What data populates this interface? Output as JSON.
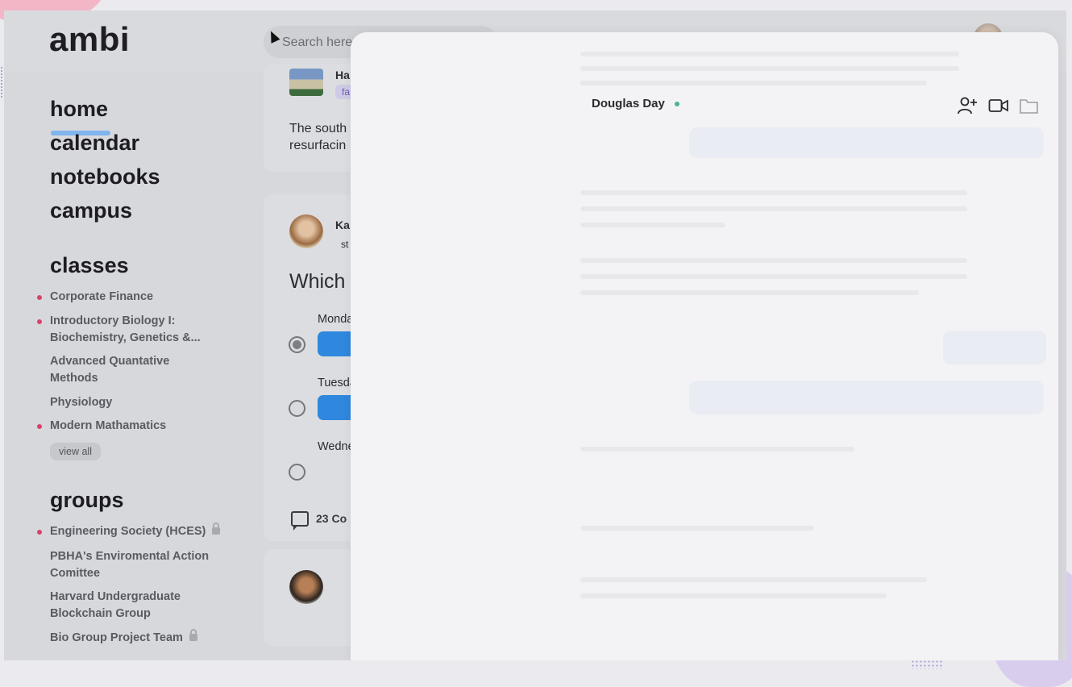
{
  "app": {
    "logo": "ambi"
  },
  "header": {
    "search_placeholder": "Search here"
  },
  "sidebar": {
    "nav": [
      "home",
      "calendar",
      "notebooks",
      "campus"
    ],
    "classes_title": "classes",
    "classes": [
      {
        "label": "Corporate Finance",
        "unread": true
      },
      {
        "label": "Introductory Biology I: Biochemistry, Genetics &...",
        "unread": true
      },
      {
        "label": "Advanced Quantative Methods",
        "unread": false
      },
      {
        "label": "Physiology",
        "unread": false
      },
      {
        "label": "Modern Mathamatics",
        "unread": true
      }
    ],
    "view_all": "view all",
    "groups_title": "groups",
    "groups": [
      {
        "label": "Engineering Society (HCES)",
        "unread": true,
        "locked": true
      },
      {
        "label": "PBHA's Enviromental Action Comittee",
        "unread": false,
        "locked": false
      },
      {
        "label": "Harvard Undergraduate Blockchain Group",
        "unread": false,
        "locked": false
      },
      {
        "label": "Bio Group Project Team",
        "unread": false,
        "locked": true
      }
    ]
  },
  "feed": {
    "post1": {
      "author_partial": "Ha",
      "tag_partial": "fa",
      "text_line1": "The south",
      "text_line2": "resurfacin"
    },
    "post2": {
      "author_partial": "Ka",
      "tag_partial": "st",
      "question_partial": "Which",
      "options": [
        {
          "label": "Monda",
          "selected": true
        },
        {
          "label": "Tuesda",
          "selected": false
        },
        {
          "label": "Wedne",
          "selected": false
        }
      ],
      "comments": "23 Co"
    }
  },
  "chat": {
    "contact_name": "Douglas Day",
    "online": true,
    "icons": [
      "add-user-icon",
      "video-call-icon",
      "folder-icon"
    ],
    "status_color": "#49b58f"
  },
  "colors": {
    "accent": "#2f87de",
    "unread_dot": "#d8426d",
    "underline": "#7fb4ee"
  }
}
